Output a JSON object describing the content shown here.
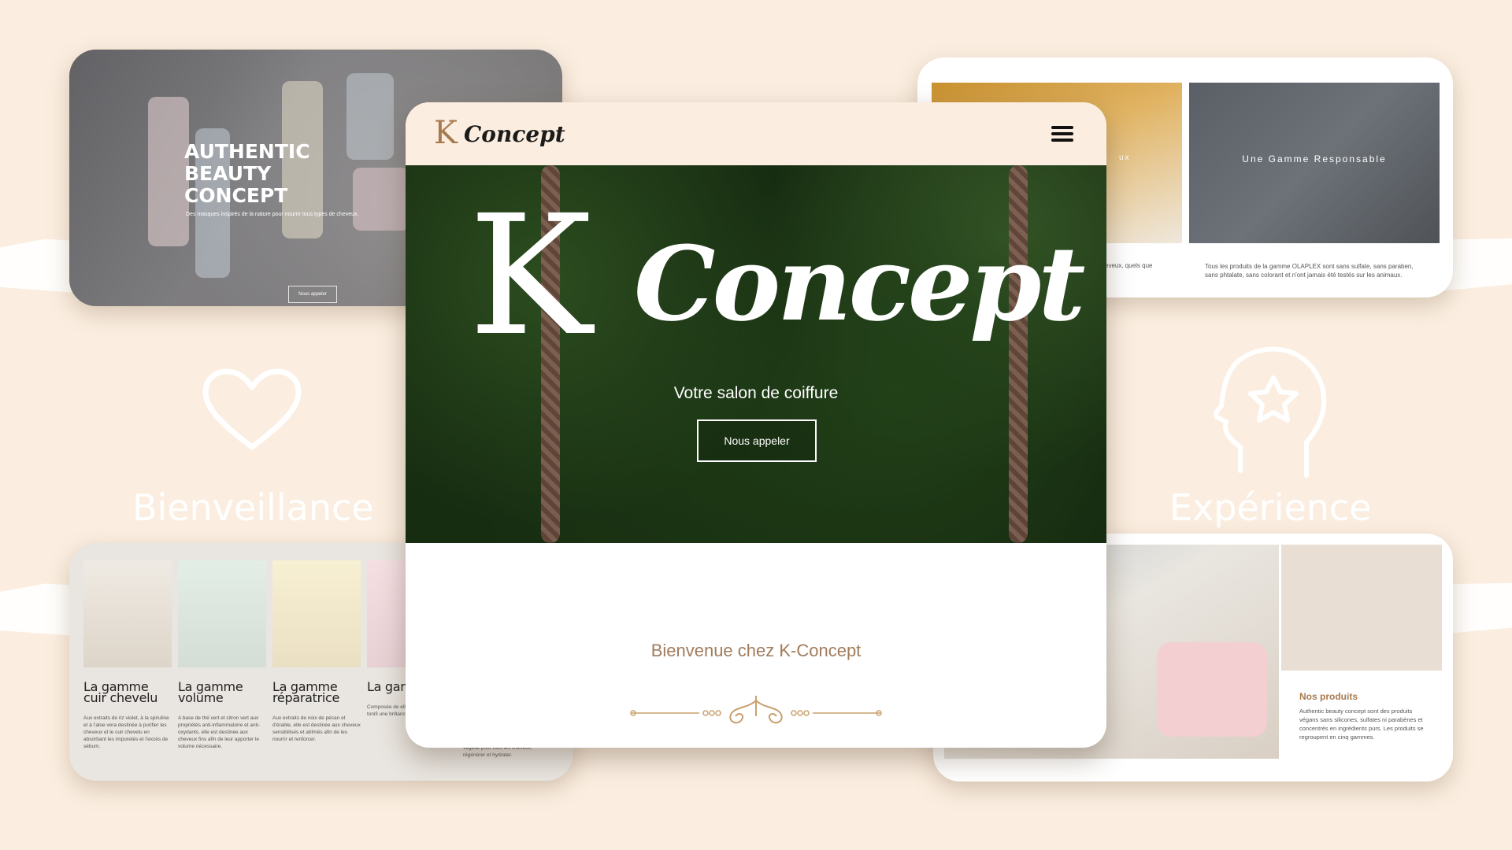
{
  "main": {
    "logo_k": "K",
    "logo_concept": "Concept",
    "hero_k": "K",
    "hero_concept": "Concept",
    "subtitle": "Votre salon de coiffure",
    "cta_label": "Nous appeler",
    "welcome": "Bienvenue chez K-Concept"
  },
  "top_left": {
    "title": "AUTHENTIC BEAUTY CONCEPT",
    "subtitle": "Des masques inspirés de la nature pour nourrir tous types de cheveux.",
    "button": "Nous appeler"
  },
  "top_right": {
    "image1_label": "ux",
    "image2_label": "Une Gamme Responsable",
    "text1": "eveux, quels que",
    "text2": "Tous les produits de la gamme OLAPLEX sont sans sulfate, sans paraben, sans phtalate, sans colorant et n'ont jamais été testés sur les animaux."
  },
  "bottom_left": {
    "items": [
      {
        "title": "La gamme cuir chevelu",
        "desc": "Aux extraits de riz violet, à la spiruline et à l'aloe vera destinée à purifier les cheveux et le cuir chevelu en absorbant les impuretés et l'excès de sébum."
      },
      {
        "title": "La gamme volume",
        "desc": "A base de thé vert et citron vert aux propriétés anti-inflammatoire et anti-oxydants, elle est destinée aux cheveux fins afin de leur apporter le volume nécessaire."
      },
      {
        "title": "La gamme réparatrice",
        "desc": "Aux extraits de noix de pécan et d'érable, elle est destinée aux cheveux sensibilisés et abîmés afin de les nourrir et renforcer."
      },
      {
        "title": "La gam brillan",
        "desc": "Composée de elle destinée afin de les tonifi une brillance nat"
      }
    ],
    "extra": "végétal pour tous les cheveux, régénérer et hydrater."
  },
  "bottom_right": {
    "heading": "Nos produits",
    "desc": "Authentic beauty concept sont des produits végans sans silicones, sulfates ni parabènes et concentrés en ingrédients purs. Les produits se regroupent en cinq gammes."
  },
  "background": {
    "word_left": "Bienveillance",
    "word_right": "Expérience",
    "icon_left": "heart-icon",
    "icon_right": "head-star-icon"
  },
  "colors": {
    "background": "#fbeee0",
    "accent": "#a87a50",
    "hero_green": "#213f19",
    "white": "#ffffff"
  }
}
